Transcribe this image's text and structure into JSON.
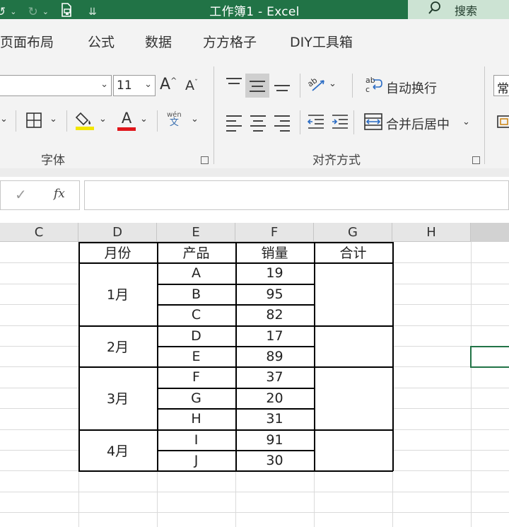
{
  "titlebar": {
    "title": "工作簿1  -  Excel",
    "search_label": "搜索"
  },
  "ribbon_tabs": [
    {
      "label": "页面布局"
    },
    {
      "label": "公式"
    },
    {
      "label": "数据"
    },
    {
      "label": "方方格子"
    },
    {
      "label": "DIY工具箱"
    }
  ],
  "font_group": {
    "font_size": "11",
    "label": "字体",
    "wen_label": "wén",
    "wen_char": "文",
    "grow_font": "A",
    "shrink_font": "A",
    "font_color_letter": "A",
    "font_color": "#e0161b",
    "fill_color": "#f2e600"
  },
  "align_group": {
    "wrap_text": "自动换行",
    "merge_center": "合并后居中",
    "label": "对齐方式"
  },
  "number_group": {
    "format_partial": "常"
  },
  "formula_bar": {
    "check": "✓",
    "fx": "fx",
    "value": ""
  },
  "columns": [
    "C",
    "D",
    "E",
    "F",
    "G",
    "H"
  ],
  "table": {
    "headers": [
      "月份",
      "产品",
      "销量",
      "合计"
    ],
    "months": [
      {
        "label": "1月",
        "items": [
          {
            "product": "A",
            "sales": "19"
          },
          {
            "product": "B",
            "sales": "95"
          },
          {
            "product": "C",
            "sales": "82"
          }
        ]
      },
      {
        "label": "2月",
        "items": [
          {
            "product": "D",
            "sales": "17"
          },
          {
            "product": "E",
            "sales": "89"
          }
        ]
      },
      {
        "label": "3月",
        "items": [
          {
            "product": "F",
            "sales": "37"
          },
          {
            "product": "G",
            "sales": "20"
          },
          {
            "product": "H",
            "sales": "31"
          }
        ]
      },
      {
        "label": "4月",
        "items": [
          {
            "product": "I",
            "sales": "91"
          },
          {
            "product": "J",
            "sales": "30"
          }
        ]
      }
    ]
  },
  "accent_color": "#217346"
}
